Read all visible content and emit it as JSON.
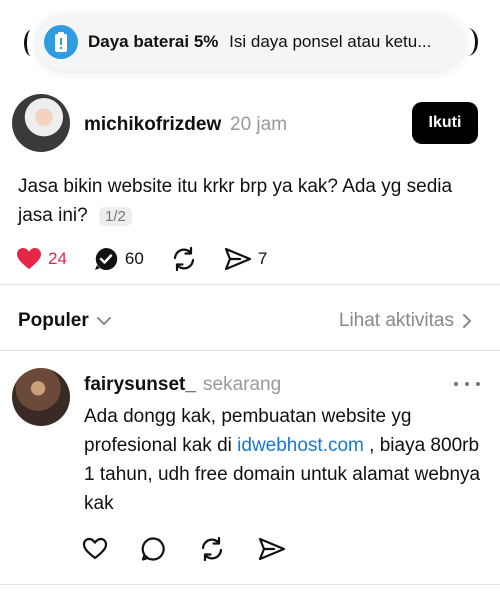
{
  "notification": {
    "title": "Daya baterai 5%",
    "body": "Isi daya ponsel atau ketu...",
    "icon": "battery-alert-icon",
    "accent": "#2f9be0"
  },
  "post": {
    "username": "michikofrizdew",
    "time": "20 jam",
    "follow_label": "Ikuti",
    "text": "Jasa bikin website itu krkr brp ya kak? Ada yg sedia jasa ini?",
    "page_indicator": "1/2",
    "likes": "24",
    "replies": "60",
    "shares": "7",
    "like_color": "#e52646"
  },
  "sort": {
    "label": "Populer",
    "activity_link": "Lihat aktivitas"
  },
  "reply": {
    "username": "fairysunset_",
    "time": "sekarang",
    "text_before_link": "Ada dongg kak, pembuatan website yg profesional kak di",
    "link_text": "idwebhost.com",
    "text_after_link": ", biaya 800rb 1 tahun, udh free domain untuk alamat webnya kak",
    "link_color": "#1877d4"
  }
}
